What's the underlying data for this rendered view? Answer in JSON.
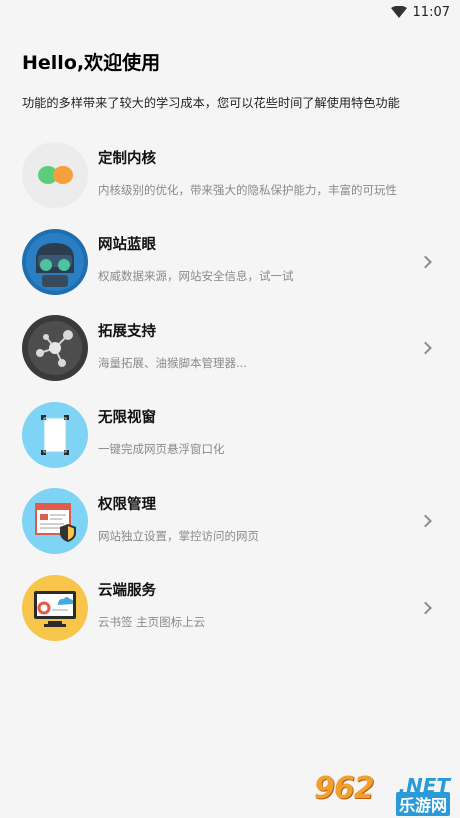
{
  "status_bar": {
    "time": "11:07"
  },
  "header": {
    "title": "Hello,欢迎使用",
    "subtitle": "功能的多样带来了较大的学习成本，您可以花些时间了解使用特色功能"
  },
  "features": [
    {
      "title": "定制内核",
      "desc": "内核级别的优化，带来强大的隐私保护能力，丰富的可玩性",
      "has_arrow": false,
      "icon": "kernel-icon"
    },
    {
      "title": "网站蓝眼",
      "desc": "权威数据来源，网站安全信息，试一试",
      "has_arrow": true,
      "icon": "blue-eye-icon"
    },
    {
      "title": "拓展支持",
      "desc": "海量拓展、油猴脚本管理器...",
      "has_arrow": true,
      "icon": "extension-icon"
    },
    {
      "title": "无限视窗",
      "desc": "一键完成网页悬浮窗口化",
      "has_arrow": false,
      "icon": "window-icon"
    },
    {
      "title": "权限管理",
      "desc": "网站独立设置，掌控访问的网页",
      "has_arrow": true,
      "icon": "permission-icon"
    },
    {
      "title": "云端服务",
      "desc": "云书签 主页图标上云",
      "has_arrow": true,
      "icon": "cloud-icon"
    }
  ],
  "watermark": {
    "number": "962",
    "domain": ".NET",
    "brand": "乐游网"
  },
  "colors": {
    "kernel_bg": "#ececec",
    "kernel_green": "#5ccd7c",
    "kernel_orange": "#f7a03a",
    "eye_bg": "#1f6fb0",
    "ext_bg": "#3a3a3a",
    "window_bg": "#7fd3f5",
    "perm_bg": "#7fd3f5",
    "cloud_bg": "#f7c54a"
  }
}
